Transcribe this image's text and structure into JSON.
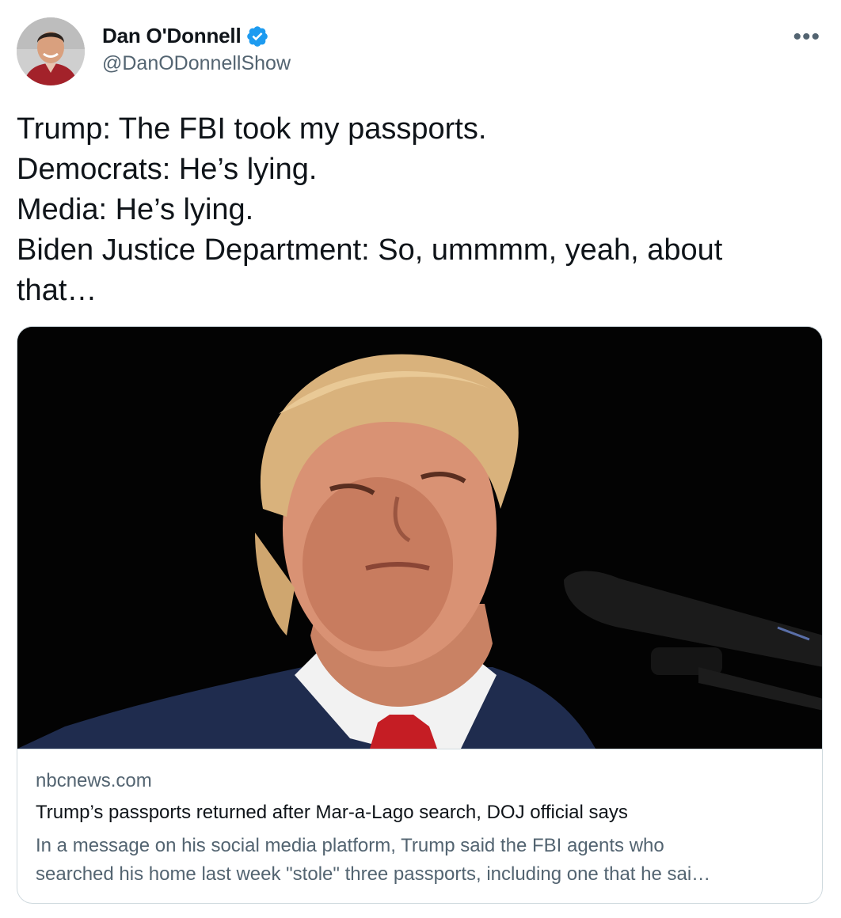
{
  "author": {
    "name": "Dan O'Donnell",
    "handle": "@DanODonnellShow",
    "avatar_icon": "profile-photo",
    "verified_icon": "verified-badge-icon"
  },
  "more_label": "•••",
  "tweet": {
    "lines": [
      "Trump: The FBI took my passports.",
      "Democrats: He’s lying.",
      "Media: He’s lying.",
      "Biden Justice Department: So, ummmm, yeah, about",
      "that…"
    ]
  },
  "card": {
    "domain": "nbcnews.com",
    "headline": "Trump’s passports returned after Mar-a-Lago search, DOJ official says",
    "description_lines": [
      "In a message on his social media platform, Trump said the FBI agents who",
      "searched his home last week \"stole\" three passports, including one that he sai…"
    ]
  },
  "colors": {
    "text": "#0f1419",
    "secondary": "#536471",
    "verified": "#1d9bf0",
    "border": "#cfd9de"
  }
}
